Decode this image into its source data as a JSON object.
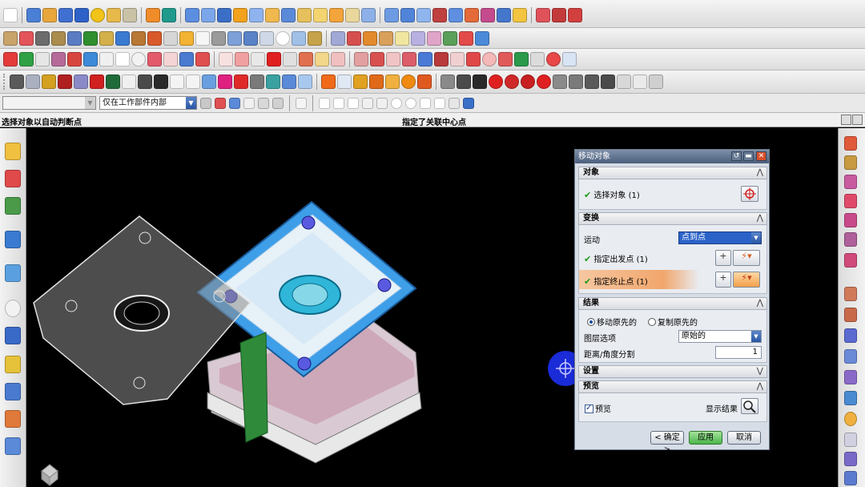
{
  "toolbar": {
    "work_part_filter": "仅在工作部件内部",
    "type_filter": ""
  },
  "status_bar": {
    "prompt": "选择对象以自动判断点",
    "message": "指定了关联中心点"
  },
  "dialog": {
    "title": "移动对象",
    "sections": {
      "object": {
        "header": "对象",
        "select_label": "选择对象 (1)"
      },
      "transform": {
        "header": "变换",
        "motion_label": "运动",
        "motion_value": "点到点",
        "from_point_label": "指定出发点 (1)",
        "to_point_label": "指定终止点 (1)"
      },
      "result": {
        "header": "结果",
        "move_original": "移动原先的",
        "copy_original": "复制原先的",
        "move_selected": true,
        "layer_label": "图层选项",
        "layer_value": "原始的",
        "divisions_label": "距离/角度分割",
        "divisions_value": "1"
      },
      "settings": {
        "header": "设置"
      },
      "preview": {
        "header": "预览",
        "preview_label": "预览",
        "preview_checked": true,
        "show_result_label": "显示结果"
      }
    },
    "buttons": {
      "ok": "< 确定 >",
      "apply": "应用",
      "cancel": "取消"
    }
  },
  "colors": {
    "accent_blue": "#2a56a4",
    "highlight_row": "#f3b27a",
    "check_green": "#1a9c1a",
    "apply_green": "#4bb54a",
    "cursor_blue": "#1a2bd8"
  }
}
